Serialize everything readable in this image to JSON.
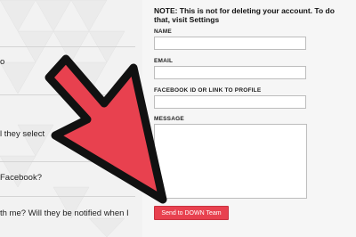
{
  "faq": {
    "lines": [
      "o",
      "l they select",
      "Facebook?",
      "th me? Will they be notified when I"
    ]
  },
  "form": {
    "note": "NOTE: This is not for deleting your account. To do that, visit Settings",
    "name_label": "NAME",
    "name_value": "",
    "email_label": "EMAIL",
    "email_value": "",
    "facebook_label": "FACEBOOK ID OR LINK TO PROFILE",
    "facebook_value": "",
    "message_label": "MESSAGE",
    "message_value": "",
    "submit_label": "Send to DOWN Team"
  },
  "colors": {
    "arrow_fill": "#e8414f",
    "arrow_outline": "#111111",
    "button_fill": "#e8414f",
    "background": "#f2f2f2"
  }
}
